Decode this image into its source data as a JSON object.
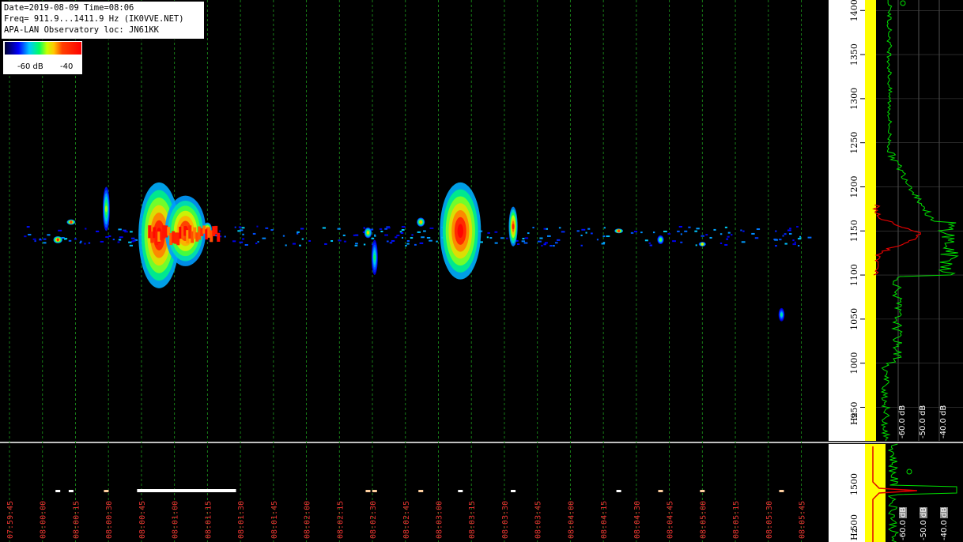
{
  "header": {
    "line1": "Date=2019-08-09 Time=08:06",
    "line2": "Freq= 911.9...1411.9 Hz (IK0VVE.NET)",
    "line3": "APA-LAN Observatory loc: JN61KK"
  },
  "colorbar": {
    "low_label": "-60 dB",
    "high_label": "-40"
  },
  "colors": {
    "low": "#0000ff",
    "mid": "#00ff60",
    "high": "#ff0000",
    "grid": "#1a8a1a",
    "timeLabel": "#e53030",
    "spectrumAvg": "#00e000",
    "spectrumPeak": "#e00000",
    "noise": "#ffff00"
  },
  "chart_data": [
    {
      "type": "heatmap",
      "name": "waterfall",
      "x_ticks": [
        "07:59:45",
        "08:00:00",
        "08:00:15",
        "08:00:30",
        "08:00:45",
        "08:01:00",
        "08:01:15",
        "08:01:30",
        "08:01:45",
        "08:02:00",
        "08:02:15",
        "08:02:30",
        "08:02:45",
        "08:03:00",
        "08:03:15",
        "08:03:30",
        "08:03:45",
        "08:04:00",
        "08:04:15",
        "08:04:30",
        "08:04:45",
        "08:05:00",
        "08:05:15",
        "08:05:30",
        "08:05:45"
      ],
      "y_ticks": [
        "950",
        "1000",
        "1050",
        "1100",
        "1150",
        "1200",
        "1250",
        "1300",
        "1350",
        "1400"
      ],
      "ylabel": "Hz",
      "ylim": [
        911.9,
        1411.9
      ],
      "zlim_db": [
        -60,
        -40
      ],
      "echoes": [
        {
          "t": "08:00:07",
          "f": 1140,
          "intensity": 0.9,
          "fspread": 8
        },
        {
          "t": "08:00:13",
          "f": 1160,
          "intensity": 0.85,
          "fspread": 6
        },
        {
          "t": "08:00:29",
          "f": 1175,
          "intensity": 0.6,
          "fspread": 50
        },
        {
          "t": "08:00:53",
          "f": 1145,
          "intensity": 1.0,
          "fspread": 120
        },
        {
          "t": "08:01:05",
          "f": 1150,
          "intensity": 0.95,
          "fspread": 80
        },
        {
          "t": "08:01:15",
          "f": 1152,
          "intensity": 0.9,
          "fspread": 15
        },
        {
          "t": "08:02:28",
          "f": 1148,
          "intensity": 0.7,
          "fspread": 12
        },
        {
          "t": "08:02:31",
          "f": 1120,
          "intensity": 0.5,
          "fspread": 40
        },
        {
          "t": "08:02:52",
          "f": 1160,
          "intensity": 0.75,
          "fspread": 10
        },
        {
          "t": "08:03:10",
          "f": 1150,
          "intensity": 1.0,
          "fspread": 110
        },
        {
          "t": "08:03:34",
          "f": 1155,
          "intensity": 0.9,
          "fspread": 45
        },
        {
          "t": "08:04:22",
          "f": 1150,
          "intensity": 0.85,
          "fspread": 5
        },
        {
          "t": "08:04:41",
          "f": 1140,
          "intensity": 0.55,
          "fspread": 10
        },
        {
          "t": "08:05:00",
          "f": 1135,
          "intensity": 0.65,
          "fspread": 5
        },
        {
          "t": "08:05:36",
          "f": 1055,
          "intensity": 0.45,
          "fspread": 15
        }
      ]
    },
    {
      "type": "line",
      "name": "spectrum-side",
      "x_ticks_db": [
        "-60.0 dB",
        "-50.0 dB",
        "-40.0 dB"
      ]
    },
    {
      "type": "line",
      "name": "mini-spectrum",
      "y_ticks": [
        "1500",
        "500"
      ],
      "ylabel": "Hz",
      "x_ticks_db": [
        "-60.0 dB",
        "-50.0 dB",
        "-40.0 dB"
      ]
    }
  ]
}
